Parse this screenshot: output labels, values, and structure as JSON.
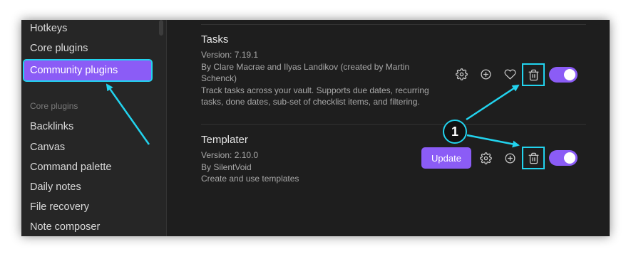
{
  "sidebar": {
    "items_top": [
      {
        "label": "Hotkeys"
      },
      {
        "label": "Core plugins"
      }
    ],
    "active_item": {
      "label": "Community plugins"
    },
    "section_heading": "Core plugins",
    "items": [
      {
        "label": "Backlinks"
      },
      {
        "label": "Canvas"
      },
      {
        "label": "Command palette"
      },
      {
        "label": "Daily notes"
      },
      {
        "label": "File recovery"
      },
      {
        "label": "Note composer"
      }
    ]
  },
  "plugins": [
    {
      "name": "Tasks",
      "version": "Version: 7.19.1",
      "author": "By Clare Macrae and Ilyas Landikov (created by Martin Schenck)",
      "description": "Track tasks across your vault. Supports due dates, recurring tasks, done dates, sub-set of checklist items, and filtering.",
      "enabled": true
    },
    {
      "name": "Templater",
      "version": "Version: 2.10.0",
      "author": "By SilentVoid",
      "description": "Create and use templates",
      "update_label": "Update",
      "enabled": true
    }
  ],
  "annotation": {
    "badge": "1",
    "color": "#22d3ee"
  },
  "colors": {
    "accent": "#8b5cf6",
    "highlight": "#22d3ee",
    "background": "#1e1e1e"
  }
}
